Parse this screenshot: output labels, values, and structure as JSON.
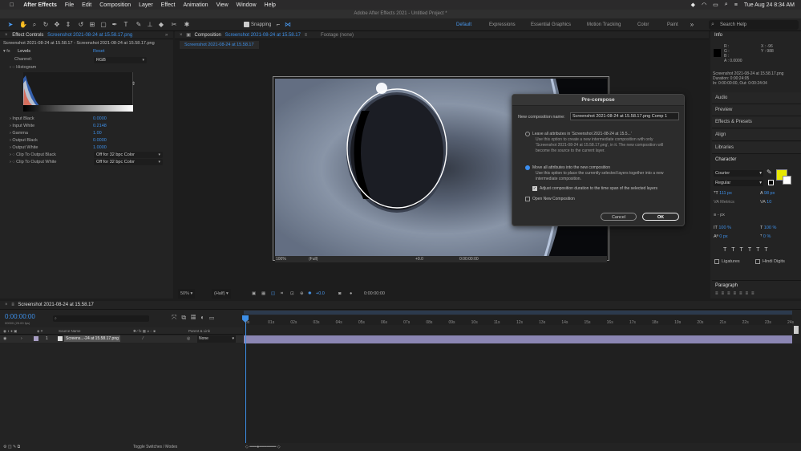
{
  "menubar": {
    "app": "After Effects",
    "items": [
      "File",
      "Edit",
      "Composition",
      "Layer",
      "Effect",
      "Animation",
      "View",
      "Window",
      "Help"
    ],
    "clock": "Tue Aug 24  8:34 AM"
  },
  "window_title": "Adobe After Effects 2021 - Untitled Project *",
  "toolbar": {
    "snapping": "Snapping",
    "workspaces": [
      "Default",
      "Expressions",
      "Essential Graphics",
      "Motion Tracking",
      "Color",
      "Paint"
    ],
    "search_placeholder": "Search Help"
  },
  "effect_controls": {
    "tab": "Effect Controls",
    "tab_file": "Screenshot 2021-08-24 at 15.58.17.png",
    "layer_path": "Screenshot 2021-08-24 at 15.58.17 - Screenshot 2021-08-24 at 15.58.17.png",
    "effect": "Levels",
    "reset": "Reset",
    "channel_label": "Channel:",
    "channel_value": "RGB",
    "histogram": "Histogram",
    "params": [
      {
        "label": "Input Black",
        "value": "0.0000"
      },
      {
        "label": "Input White",
        "value": "0.2148"
      },
      {
        "label": "Gamma",
        "value": "1.00"
      },
      {
        "label": "Output Black",
        "value": "0.0000"
      },
      {
        "label": "Output White",
        "value": "1.0000"
      },
      {
        "label": "Clip To Output Black",
        "value": "Off for 32 bpc Color"
      },
      {
        "label": "Clip To Output White",
        "value": "Off for 32 bpc Color"
      }
    ]
  },
  "composition": {
    "tab": "Composition",
    "tab_name": "Screenshot 2021-08-24 at 15.58.17",
    "footage": "Footage (none)",
    "subtab": "Screenshot 2021-08-24 at 15.58.17",
    "zoom": "50%",
    "resolution": "(Half)",
    "exposure": "+0.0",
    "timecode": "0:00:00:00",
    "inner_zoom": "100%",
    "inner_res": "(Full)",
    "inner_exposure": "+0.0",
    "inner_timecode": "0:00:00:00"
  },
  "dialog": {
    "title": "Pre-compose",
    "name_label": "New composition name:",
    "name_value": "Screenshot 2021-08-24 at 15.58.17.png Comp 1",
    "opt1": "Leave all attributes in 'Screenshot 2021-08-24 at 15.5...'",
    "opt1_desc": [
      "Use this option to create a new intermediate composition with only",
      "'Screenshot 2021-08-24 at 15.58.17.png', in it. The new composition will",
      "become the source to the current layer."
    ],
    "opt2": "Move all attributes into the new composition",
    "opt2_desc": [
      "Use this option to place the currently selected layers together into a new",
      "intermediate composition."
    ],
    "adjust": "Adjust composition duration to the time span of the selected layers",
    "open_new": "Open New Composition",
    "cancel": "Cancel",
    "ok": "OK"
  },
  "info": {
    "title": "Info",
    "r": "R :",
    "g": "G :",
    "b": "B :",
    "a": "A :  0.0000",
    "x": "X : -96",
    "y": "Y : 988",
    "file": "Screenshot 2021-08-24 at 15.58.17.png",
    "duration": "Duration: 0:00:24:05",
    "inout": "In: 0:00:00:00, Out: 0:00:24:04"
  },
  "right_panels": [
    "Audio",
    "Preview",
    "Effects & Presets",
    "Align",
    "Libraries"
  ],
  "character": {
    "title": "Character",
    "font": "Courier",
    "style": "Regular",
    "size": "111 px",
    "leading": "98 px",
    "kerning": "Metrics",
    "tracking": "10",
    "stroke": "- px",
    "vscale": "100 %",
    "hscale": "100 %",
    "baseline": "0 px",
    "tsume": "0 %",
    "ligatures": "Ligatures",
    "hindi": "Hindi Digits",
    "paragraph": "Paragraph",
    "fill": "#e7e800"
  },
  "timeline": {
    "tab": "Screenshot 2021-08-24 at 15.58.17",
    "timecode": "0:00:00:00",
    "fps": "00000 (25.00 fps)",
    "col_source": "Source Name",
    "col_parent": "Parent & Link",
    "layer_num": "1",
    "layer_name": "Screens...-24 at 15.58.17.png",
    "parent_value": "None",
    "ticks": [
      "0s",
      "01s",
      "02s",
      "03s",
      "04s",
      "05s",
      "06s",
      "07s",
      "08s",
      "09s",
      "10s",
      "11s",
      "12s",
      "13s",
      "14s",
      "15s",
      "16s",
      "17s",
      "18s",
      "19s",
      "20s",
      "21s",
      "22s",
      "23s",
      "24s"
    ],
    "toggle": "Toggle Switches / Modes"
  }
}
